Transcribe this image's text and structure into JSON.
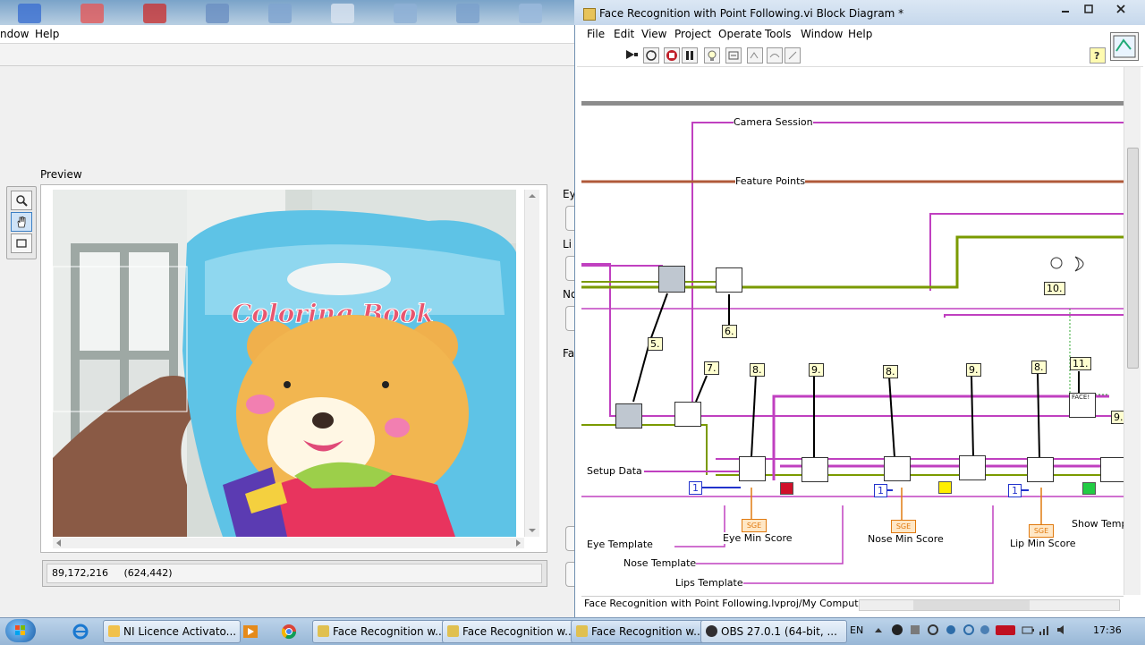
{
  "front_panel": {
    "menu": [
      "ndow",
      "Help"
    ],
    "preview_label": "Preview",
    "status_text": "89,172,216     (624,442)",
    "side_labels": [
      "Ey",
      "Li",
      "No",
      "Fa"
    ],
    "camera_book_title": "Coloring Book"
  },
  "block_diagram": {
    "title": "Face Recognition with Point Following.vi Block Diagram *",
    "menu": [
      "File",
      "Edit",
      "View",
      "Project",
      "Operate",
      "Tools",
      "Window",
      "Help"
    ],
    "wire_labels": {
      "camera_session": "Camera Session",
      "feature_points": "Feature Points",
      "setup_data": "Setup Data",
      "eye_template": "Eye Template",
      "nose_template": "Nose Template",
      "lips_template": "Lips Template",
      "eye_min_score": "Eye Min Score",
      "nose_min_score": "Nose Min Score",
      "lip_min_score": "Lip Min Score",
      "show_template": "Show Temp"
    },
    "step_tags": [
      "5.",
      "6.",
      "7.",
      "8.",
      "9.",
      "8.",
      "9.",
      "8.",
      "11.",
      "10.",
      "9."
    ],
    "constants": [
      "1",
      "1",
      "1"
    ],
    "sge_label": "SGE",
    "face_label": "FACE!",
    "status_path": "Face Recognition with Point Following.lvproj/My Computer",
    "colors": {
      "wire_pink": "#c040c0",
      "wire_brown": "#b05a3a",
      "wire_green": "#7a9a00",
      "wire_blue": "#2233cc",
      "red_const": "#d0102a",
      "yellow_const": "#ffee00",
      "green_const": "#22cc44"
    }
  },
  "taskbar": {
    "items": [
      "NI Licence Activato...",
      "Face Recognition w...",
      "Face Recognition w...",
      "Face Recognition w...",
      "OBS 27.0.1 (64-bit, ..."
    ],
    "language": "EN",
    "clock": "17:36"
  }
}
